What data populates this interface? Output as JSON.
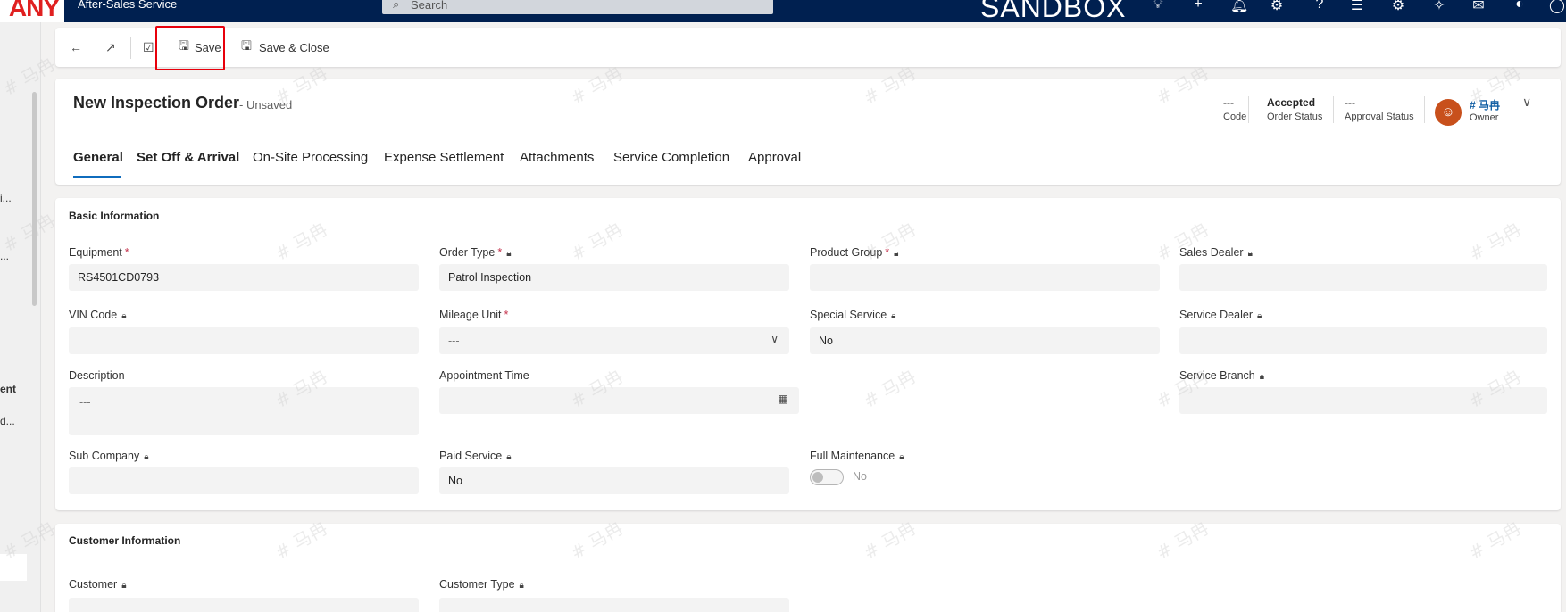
{
  "topbar": {
    "brand": "ANY",
    "app_title": "After-Sales Service",
    "search_placeholder": "Search",
    "environment": "SANDBOX"
  },
  "leftnav": {
    "items": [
      "i...",
      "...",
      "ent",
      "d..."
    ]
  },
  "commandbar": {
    "save_label": "Save",
    "save_close_label": "Save & Close"
  },
  "header": {
    "title": "New Inspection Order",
    "unsaved": "- Unsaved",
    "code_value": "---",
    "code_label": "Code",
    "order_status_value": "Accepted",
    "order_status_label": "Order Status",
    "approval_status_value": "---",
    "approval_status_label": "Approval Status",
    "owner_name": "# 马冉",
    "owner_label": "Owner",
    "tabs": [
      "General",
      "Set Off & Arrival",
      "On-Site Processing",
      "Expense Settlement",
      "Attachments",
      "Service Completion",
      "Approval"
    ]
  },
  "watermark": "# 马冉",
  "basic_info": {
    "title": "Basic Information",
    "equipment_label": "Equipment",
    "equipment_value": "RS4501CD0793",
    "order_type_label": "Order Type",
    "order_type_value": "Patrol Inspection",
    "product_group_label": "Product Group",
    "product_group_value": "",
    "sales_dealer_label": "Sales Dealer",
    "sales_dealer_value": "",
    "vin_code_label": "VIN Code",
    "vin_code_value": "",
    "mileage_unit_label": "Mileage Unit",
    "mileage_unit_value": "---",
    "special_service_label": "Special Service",
    "special_service_value": "No",
    "service_dealer_label": "Service Dealer",
    "service_dealer_value": "",
    "description_label": "Description",
    "description_value": "---",
    "appointment_time_label": "Appointment Time",
    "appointment_time_value": "---",
    "service_branch_label": "Service Branch",
    "service_branch_value": "",
    "sub_company_label": "Sub Company",
    "sub_company_value": "",
    "paid_service_label": "Paid Service",
    "paid_service_value": "No",
    "full_maintenance_label": "Full Maintenance",
    "full_maintenance_value": "No"
  },
  "customer_info": {
    "title": "Customer Information",
    "customer_label": "Customer",
    "customer_type_label": "Customer Type"
  }
}
